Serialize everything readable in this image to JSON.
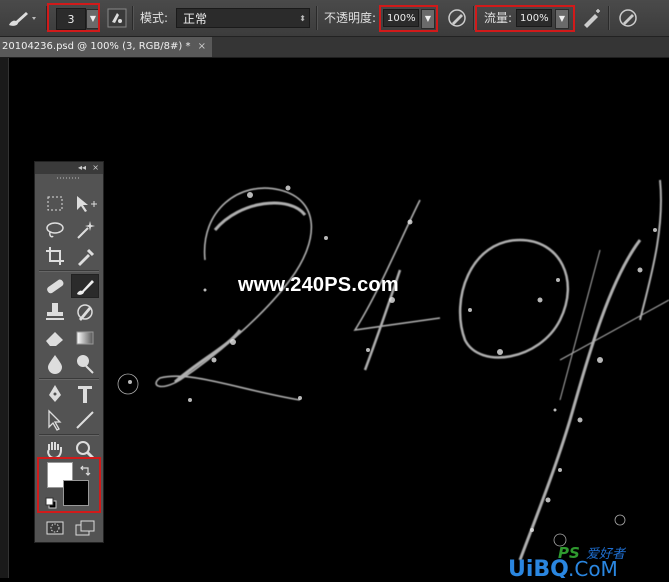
{
  "options_bar": {
    "brush_size": "3",
    "mode_label": "模式:",
    "mode_value": "正常",
    "opacity_label": "不透明度:",
    "opacity_value": "100%",
    "flow_label": "流量:",
    "flow_value": "100%"
  },
  "document_tab": {
    "title": "20104236.psd @ 100% (3, RGB/8#) *",
    "close": "×"
  },
  "canvas": {
    "watermark": "www.240PS.com"
  },
  "tools_panel": {
    "collapse_glyph": "◂◂",
    "close_glyph": "×",
    "foreground_color": "#ffffff",
    "background_color": "#000000"
  },
  "highlight_color": "#d11a1a"
}
